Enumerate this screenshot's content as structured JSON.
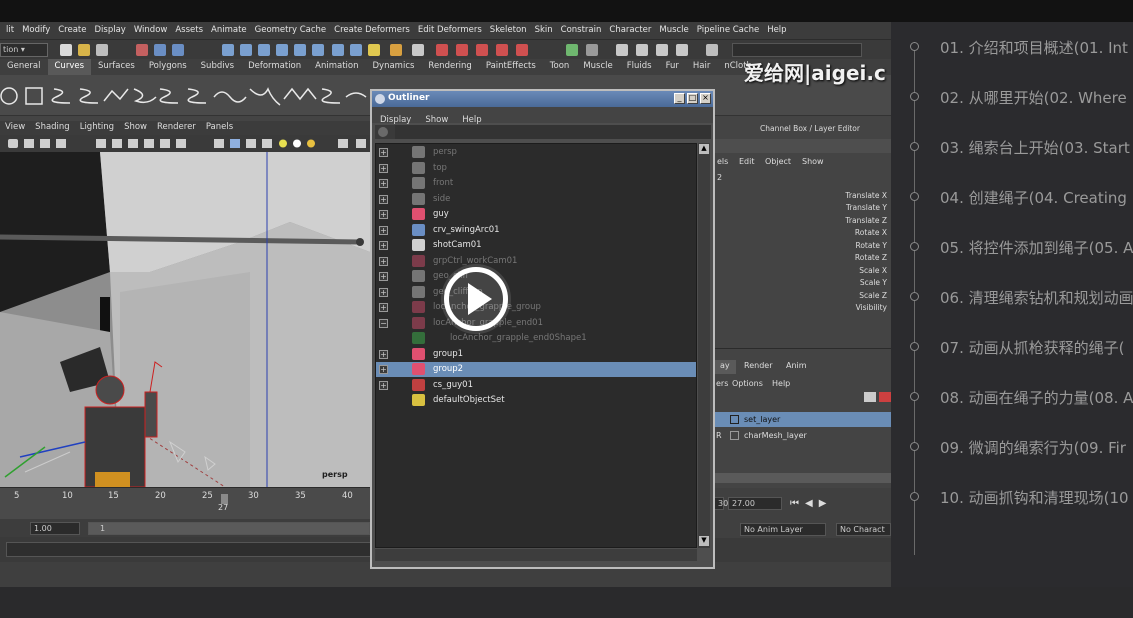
{
  "maya": {
    "menubar": [
      "lit",
      "Modify",
      "Create",
      "Display",
      "Window",
      "Assets",
      "Animate",
      "Geometry Cache",
      "Create Deformers",
      "Edit Deformers",
      "Skeleton",
      "Skin",
      "Constrain",
      "Character",
      "Muscle",
      "Pipeline Cache",
      "Help"
    ],
    "mode_selector": "tion",
    "shelf_tabs": [
      "General",
      "Curves",
      "Surfaces",
      "Polygons",
      "Subdivs",
      "Deformation",
      "Animation",
      "Dynamics",
      "Rendering",
      "PaintEffects",
      "Toon",
      "Muscle",
      "Fluids",
      "Fur",
      "Hair",
      "nCloth"
    ],
    "active_shelf_tab": "Curves",
    "panel_menu": [
      "View",
      "Shading",
      "Lighting",
      "Show",
      "Renderer",
      "Panels"
    ],
    "viewport_camera_label": "persp",
    "timeline": {
      "ticks": [
        "5",
        "10",
        "15",
        "20",
        "25",
        "30",
        "35",
        "40"
      ],
      "current_frame": "27",
      "current_frame_field": "27.00",
      "end_tick": "30"
    },
    "range": {
      "start_field": "1.00",
      "range_start": "1"
    },
    "channel_box": {
      "title": "Channel Box / Layer Editor",
      "menu": [
        "els",
        "Edit",
        "Object",
        "Show"
      ],
      "object_suffix": "2",
      "attributes": [
        "Translate X",
        "Translate Y",
        "Translate Z",
        "Rotate X",
        "Rotate Y",
        "Rotate Z",
        "Scale X",
        "Scale Y",
        "Scale Z",
        "Visibility"
      ]
    },
    "layer_editor": {
      "tabs": [
        "ay",
        "Render",
        "Anim"
      ],
      "active_tab": "ay",
      "menu": [
        "ers",
        "Options",
        "Help"
      ],
      "layers": [
        {
          "flag": "",
          "name": "set_layer",
          "selected": true
        },
        {
          "flag": "R",
          "name": "charMesh_layer",
          "selected": false
        }
      ]
    },
    "anim_layer_field": "No Anim Layer",
    "character_field": "No Charact"
  },
  "outliner": {
    "title": "Outliner",
    "menu": [
      "Display",
      "Show",
      "Help"
    ],
    "rows": [
      {
        "label": "persp",
        "icon": "camera-icon",
        "expander": "+",
        "dim": true,
        "selected": false,
        "indent": 0
      },
      {
        "label": "top",
        "icon": "camera-icon",
        "expander": "+",
        "dim": true,
        "selected": false,
        "indent": 0
      },
      {
        "label": "front",
        "icon": "camera-icon",
        "expander": "+",
        "dim": true,
        "selected": false,
        "indent": 0
      },
      {
        "label": "side",
        "icon": "camera-icon",
        "expander": "+",
        "dim": true,
        "selected": false,
        "indent": 0
      },
      {
        "label": "guy",
        "icon": "transform-icon",
        "expander": "+",
        "dim": false,
        "selected": false,
        "indent": 0
      },
      {
        "label": "crv_swingArc01",
        "icon": "curve-icon",
        "expander": "+",
        "dim": false,
        "selected": false,
        "indent": 0
      },
      {
        "label": "shotCam01",
        "icon": "camera-icon",
        "expander": "+",
        "dim": false,
        "selected": false,
        "indent": 0
      },
      {
        "label": "grpCtrl_workCam01",
        "icon": "transform-icon",
        "expander": "+",
        "dim": true,
        "selected": false,
        "indent": 0
      },
      {
        "label": "geo_cliff",
        "icon": "camera-icon",
        "expander": "+",
        "dim": true,
        "selected": false,
        "indent": 0
      },
      {
        "label": "geo_cliffTop",
        "icon": "camera-icon",
        "expander": "+",
        "dim": true,
        "selected": false,
        "indent": 0
      },
      {
        "label": "locAnchor_grapple_group",
        "icon": "transform-icon",
        "expander": "+",
        "dim": true,
        "selected": false,
        "indent": 0
      },
      {
        "label": "locAnchor_grapple_end01",
        "icon": "transform-icon",
        "expander": "−",
        "dim": true,
        "selected": false,
        "indent": 0
      },
      {
        "label": "locAnchor_grapple_end0Shape1",
        "icon": "locator-icon",
        "expander": "",
        "dim": true,
        "selected": false,
        "indent": 1
      },
      {
        "label": "group1",
        "icon": "transform-icon",
        "expander": "+",
        "dim": false,
        "selected": false,
        "indent": 0
      },
      {
        "label": "group2",
        "icon": "transform-icon",
        "expander": "+",
        "dim": false,
        "selected": true,
        "indent": 0
      },
      {
        "label": "cs_guy01",
        "icon": "joint-icon",
        "expander": "+",
        "dim": false,
        "selected": false,
        "indent": 0
      },
      {
        "label": "defaultObjectSet",
        "icon": "set-icon",
        "expander": "",
        "dim": false,
        "selected": false,
        "indent": 0
      }
    ]
  },
  "watermark": "爱给网|aigei.c",
  "playlist": [
    "01. 介绍和项目概述(01. Int",
    "02. 从哪里开始(02. Where",
    "03. 绳索台上开始(03. Start",
    "04. 创建绳子(04. Creating",
    "05. 将控件添加到绳子(05. A",
    "06. 清理绳索钻机和规划动画",
    "07. 动画从抓枪获释的绳子(",
    "08. 动画在绳子的力量(08. A",
    "09. 微调的绳索行为(09. Fir",
    "10. 动画抓钩和清理现场(10"
  ],
  "colors": {
    "selection": "#6a8db6",
    "title_gradient": "#4a6a98",
    "layer_selected": "#6a8db6"
  }
}
